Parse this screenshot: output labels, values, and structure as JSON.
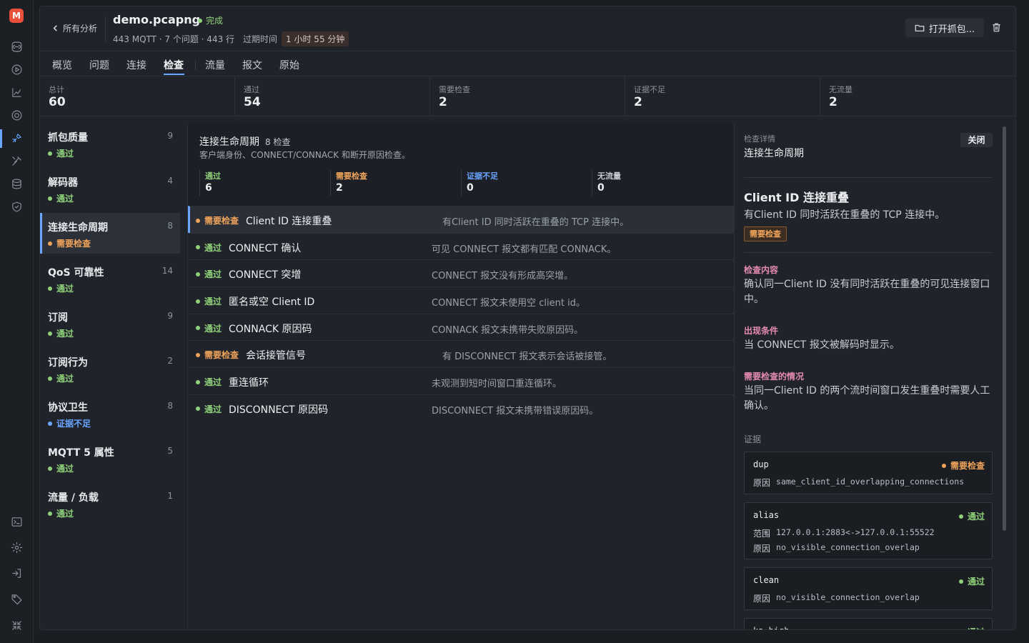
{
  "app": {
    "logo_letter": "M"
  },
  "header": {
    "back_label": "所有分析",
    "file_name": "demo.pcapng",
    "status": "完成",
    "meta": "443 MQTT · 7 个问题 · 443 行",
    "expiry_label": "过期时间",
    "expiry_value": "1 小时 55 分钟",
    "open_button": "打开抓包..."
  },
  "tabs": [
    "概览",
    "问题",
    "连接",
    "检查",
    "流量",
    "报文",
    "原始"
  ],
  "active_tab": "检查",
  "stats": [
    {
      "label": "总计",
      "value": "60"
    },
    {
      "label": "通过",
      "value": "54"
    },
    {
      "label": "需要检查",
      "value": "2"
    },
    {
      "label": "证据不足",
      "value": "2"
    },
    {
      "label": "无流量",
      "value": "2"
    }
  ],
  "categories": [
    {
      "name": "抓包质量",
      "count": "9",
      "status": "通过",
      "kind": "pass"
    },
    {
      "name": "解码器",
      "count": "4",
      "status": "通过",
      "kind": "pass"
    },
    {
      "name": "连接生命周期",
      "count": "8",
      "status": "需要检查",
      "kind": "review",
      "selected": true
    },
    {
      "name": "QoS 可靠性",
      "count": "14",
      "status": "通过",
      "kind": "pass"
    },
    {
      "name": "订阅",
      "count": "9",
      "status": "通过",
      "kind": "pass"
    },
    {
      "name": "订阅行为",
      "count": "2",
      "status": "通过",
      "kind": "pass"
    },
    {
      "name": "协议卫生",
      "count": "8",
      "status": "证据不足",
      "kind": "insuf"
    },
    {
      "name": "MQTT 5 属性",
      "count": "5",
      "status": "通过",
      "kind": "pass"
    },
    {
      "name": "流量 / 负载",
      "count": "1",
      "status": "通过",
      "kind": "pass"
    }
  ],
  "summary": {
    "title": "连接生命周期",
    "count": "8 检查",
    "desc": "客户端身份、CONNECT/CONNACK 和断开原因检查。",
    "breakdown": [
      {
        "label": "通过",
        "value": "6",
        "kind": "pass"
      },
      {
        "label": "需要检查",
        "value": "2",
        "kind": "review"
      },
      {
        "label": "证据不足",
        "value": "0",
        "kind": "insuf"
      },
      {
        "label": "无流量",
        "value": "0",
        "kind": "noflow"
      }
    ]
  },
  "checks": [
    {
      "status": "需要检查",
      "kind": "review",
      "name": "Client ID 连接重叠",
      "desc": "有Client ID 同时活跃在重叠的 TCP 连接中。",
      "selected": true
    },
    {
      "status": "通过",
      "kind": "pass",
      "name": "CONNECT 确认",
      "desc": "可见 CONNECT 报文都有匹配 CONNACK。"
    },
    {
      "status": "通过",
      "kind": "pass",
      "name": "CONNECT 突增",
      "desc": "CONNECT 报文没有形成高突增。"
    },
    {
      "status": "通过",
      "kind": "pass",
      "name": "匿名或空 Client ID",
      "desc": "CONNECT 报文未使用空 client id。"
    },
    {
      "status": "通过",
      "kind": "pass",
      "name": "CONNACK 原因码",
      "desc": "CONNACK 报文未携带失败原因码。"
    },
    {
      "status": "需要检查",
      "kind": "review",
      "name": "会话接管信号",
      "desc": "有 DISCONNECT 报文表示会话被接管。"
    },
    {
      "status": "通过",
      "kind": "pass",
      "name": "重连循环",
      "desc": "未观测到短时间窗口重连循环。"
    },
    {
      "status": "通过",
      "kind": "pass",
      "name": "DISCONNECT 原因码",
      "desc": "DISCONNECT 报文未携带错误原因码。"
    }
  ],
  "detail": {
    "header_label": "检查详情",
    "header_title": "连接生命周期",
    "close_label": "关闭",
    "title": "Client ID 连接重叠",
    "desc": "有Client ID 同时活跃在重叠的 TCP 连接中。",
    "tag": "需要检查",
    "sections": [
      {
        "heading": "检查内容",
        "body": "确认同一Client ID 没有同时活跃在重叠的可见连接窗口中。"
      },
      {
        "heading": "出现条件",
        "body": "当 CONNECT 报文被解码时显示。"
      },
      {
        "heading": "需要检查的情况",
        "body": "当同一Client ID 的两个流时间窗口发生重叠时需要人工确认。"
      }
    ],
    "evidence_label": "证据",
    "evidence": [
      {
        "name": "dup",
        "status": "需要检查",
        "kind": "review",
        "rows": [
          {
            "k": "原因",
            "v": "same_client_id_overlapping_connections"
          }
        ]
      },
      {
        "name": "alias",
        "status": "通过",
        "kind": "pass",
        "rows": [
          {
            "k": "范围",
            "v": "127.0.0.1:2883<->127.0.0.1:55522"
          },
          {
            "k": "原因",
            "v": "no_visible_connection_overlap"
          }
        ]
      },
      {
        "name": "clean",
        "status": "通过",
        "kind": "pass",
        "rows": [
          {
            "k": "原因",
            "v": "no_visible_connection_overlap"
          }
        ]
      },
      {
        "name": "ka_high",
        "status": "通过",
        "kind": "pass",
        "rows": []
      }
    ]
  },
  "colors": {
    "accent": "#6aa6ff",
    "pass": "#8fd17b",
    "review": "#f0a35a",
    "insufficient": "#6aa6ff",
    "brand": "#e8503a"
  }
}
